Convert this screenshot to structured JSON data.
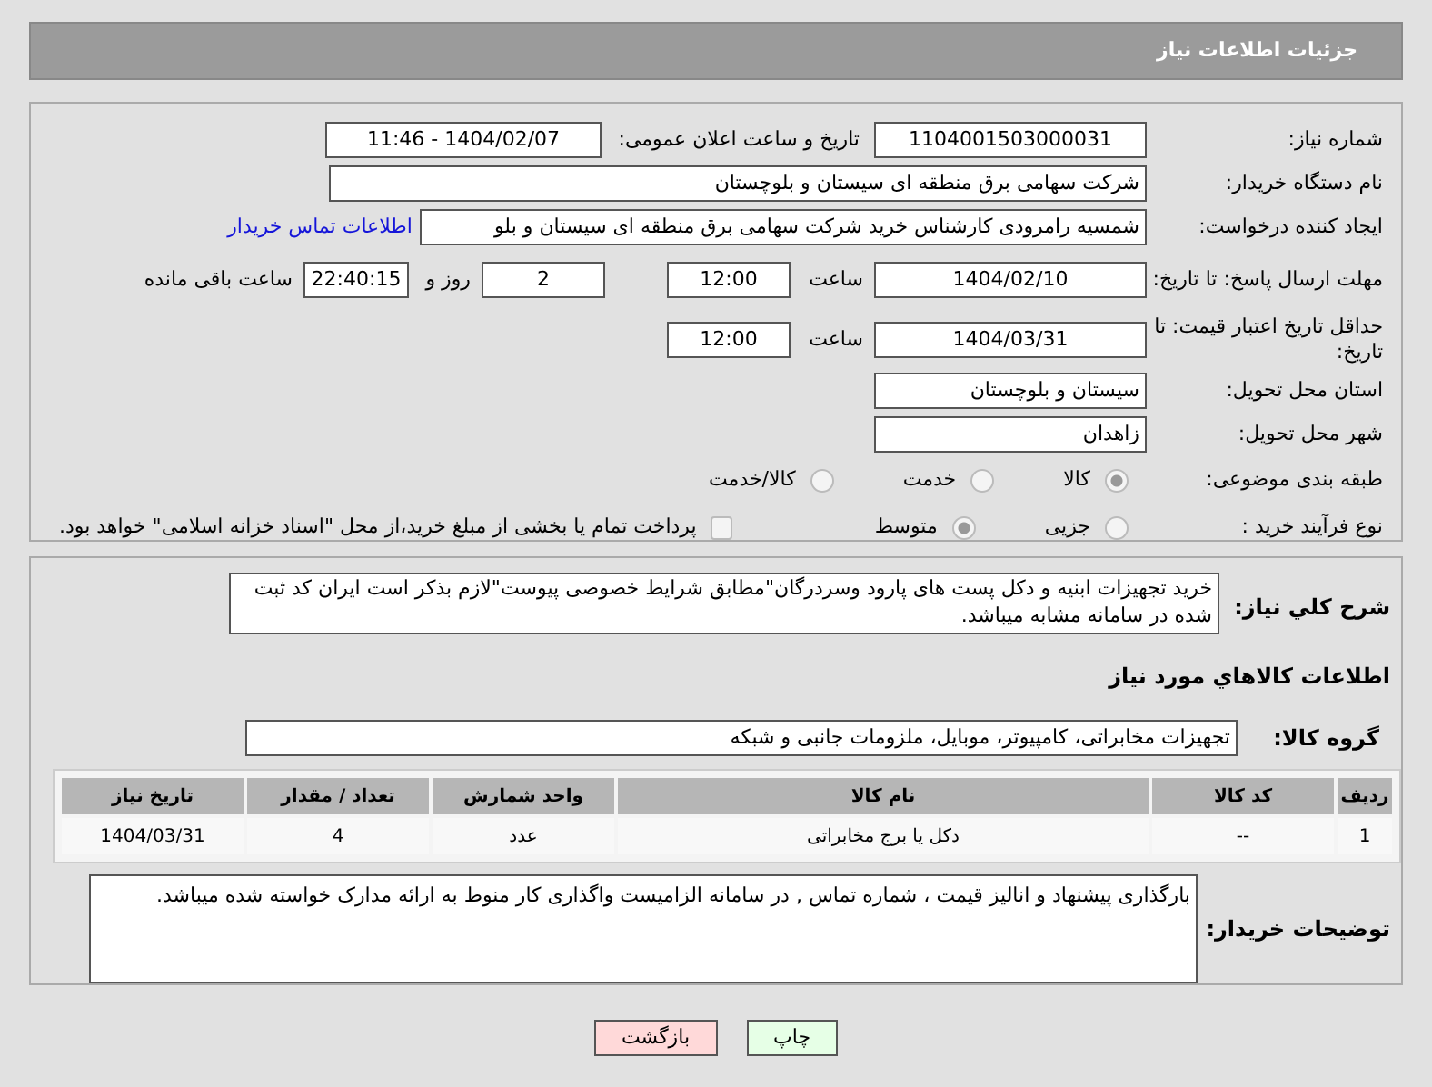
{
  "header": {
    "title": "جزئیات اطلاعات نیاز"
  },
  "need_number": {
    "label": "شماره نیاز:",
    "value": "1104001503000031"
  },
  "announce": {
    "label": "تاریخ و ساعت اعلان عمومی:",
    "value": "1404/02/07 - 11:46"
  },
  "buyer": {
    "label": "نام دستگاه خریدار:",
    "value": "شرکت سهامی برق منطقه ای سیستان و بلوچستان"
  },
  "requester": {
    "label": "ایجاد کننده درخواست:",
    "value": "شمسیه رامرودی کارشناس خرید شرکت سهامی برق منطقه ای سیستان و بلو",
    "link": "اطلاعات تماس خریدار"
  },
  "deadline": {
    "label": "مهلت ارسال پاسخ: تا تاریخ:",
    "date": "1404/02/10",
    "time_label": "ساعت",
    "time": "12:00",
    "days": "2",
    "days_label": "روز و",
    "remaining": "22:40:15",
    "remaining_label": "ساعت باقی مانده"
  },
  "validity": {
    "label": "حداقل تاریخ اعتبار قیمت: تا تاریخ:",
    "date": "1404/03/31",
    "time_label": "ساعت",
    "time": "12:00"
  },
  "province": {
    "label": "استان محل تحویل:",
    "value": "سیستان و بلوچستان"
  },
  "city": {
    "label": "شهر محل تحویل:",
    "value": "زاهدان"
  },
  "category": {
    "label": "طبقه بندی موضوعی:",
    "options": [
      {
        "label": "کالا",
        "selected": true
      },
      {
        "label": "خدمت",
        "selected": false
      },
      {
        "label": "کالا/خدمت",
        "selected": false
      }
    ]
  },
  "process": {
    "label": "نوع فرآیند خرید :",
    "options": [
      {
        "label": "جزیی",
        "selected": false
      },
      {
        "label": "متوسط",
        "selected": true
      }
    ],
    "payment": {
      "label": "پرداخت تمام یا بخشی از مبلغ خرید،از محل \"اسناد خزانه اسلامی\" خواهد بود.",
      "checked": false
    }
  },
  "description": {
    "label": "شرح کلي نياز:",
    "value": "خرید تجهیزات ابنیه و دکل پست های پارود وسردرگان\"مطابق شرایط خصوصی پیوست\"لازم بذکر است ایران کد ثبت شده در سامانه مشابه میباشد."
  },
  "goods_title": "اطلاعات کالاهاي مورد نياز",
  "goods_group": {
    "label": "گروه کالا:",
    "value": "تجهیزات مخابراتی، کامپیوتر، موبایل، ملزومات جانبی و شبکه"
  },
  "table": {
    "columns": [
      "ردیف",
      "کد کالا",
      "نام کالا",
      "واحد شمارش",
      "تعداد / مقدار",
      "تاریخ نیاز"
    ],
    "rows": [
      [
        "1",
        "--",
        "دکل یا برج مخابراتی",
        "عدد",
        "4",
        "1404/03/31"
      ]
    ]
  },
  "buyer_notes": {
    "label": "توضیحات خریدار:",
    "value": "بارگذاری پیشنهاد و انالیز قیمت ، شماره تماس , در سامانه الزامیست واگذاری کار منوط به ارائه مدارک خواسته شده میباشد."
  },
  "buttons": [
    {
      "label": "چاپ",
      "kind": "print"
    },
    {
      "label": "بازگشت",
      "kind": "back"
    }
  ]
}
